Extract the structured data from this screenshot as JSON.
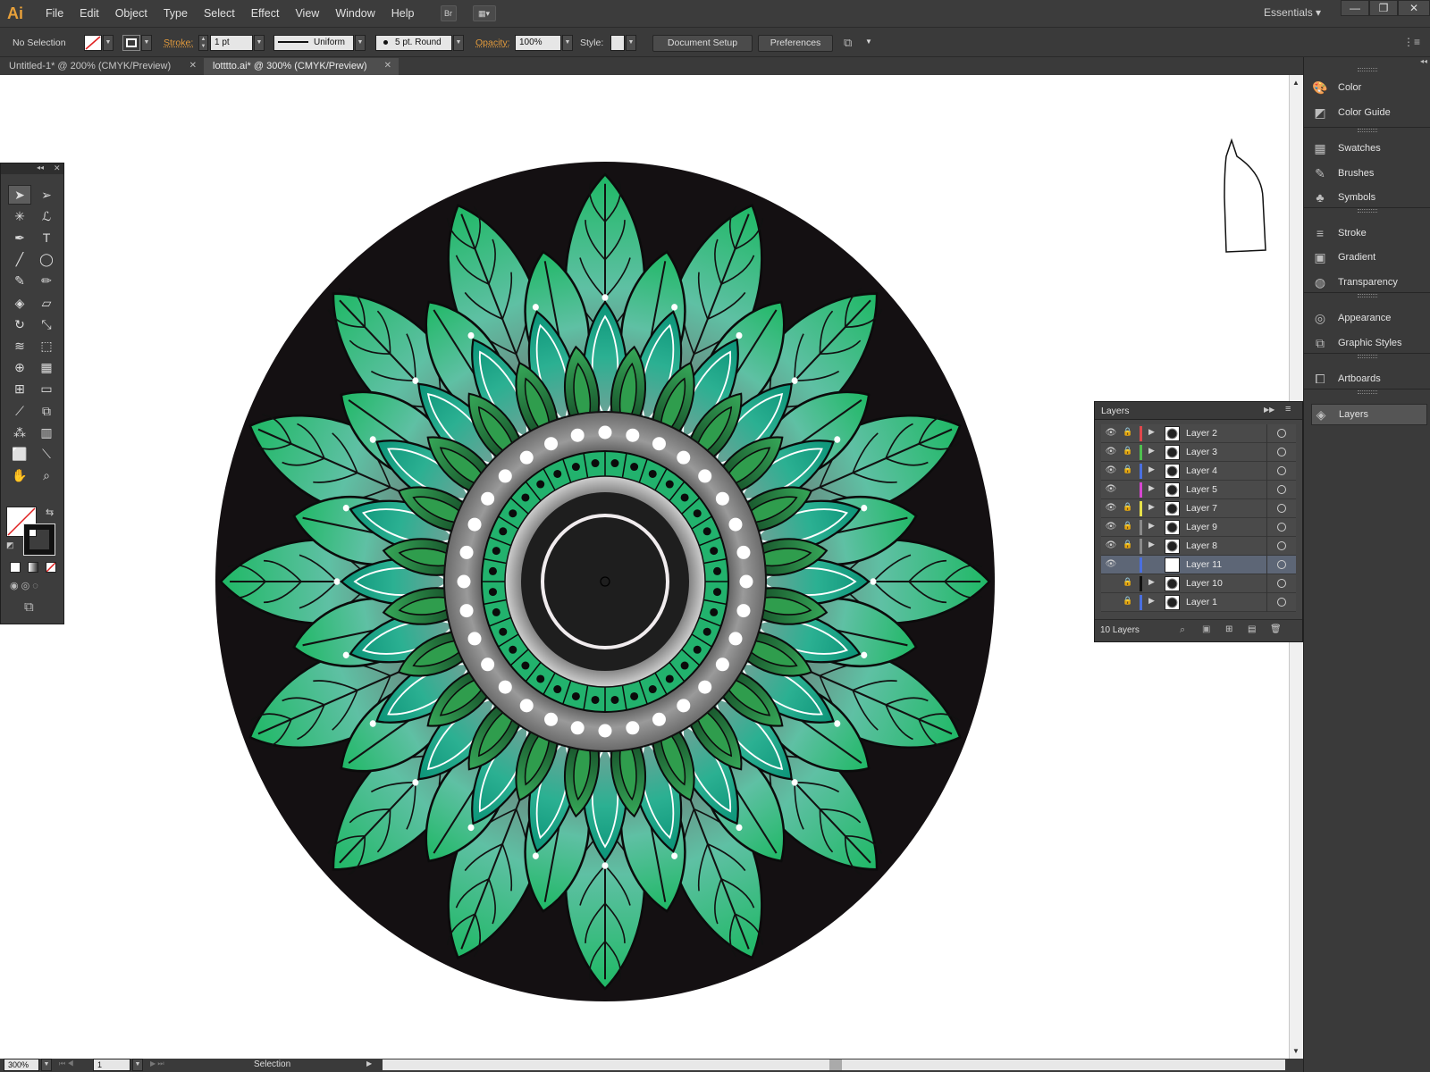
{
  "app": {
    "logo": "Ai"
  },
  "menu": [
    "File",
    "Edit",
    "Object",
    "Type",
    "Select",
    "Effect",
    "View",
    "Window",
    "Help"
  ],
  "menubar_extra": {
    "bridge_label": "Br",
    "workspace": "Essentials",
    "workspace_arrow": "▾"
  },
  "window_controls": {
    "minimize": "—",
    "restore": "❐",
    "close": "✕"
  },
  "control_bar": {
    "selection_status": "No Selection",
    "stroke_label": "Stroke:",
    "stroke_weight": "1 pt",
    "stroke_profile": "Uniform",
    "brush_def": "5 pt. Round",
    "opacity_label": "Opacity:",
    "opacity_value": "100%",
    "style_label": "Style:",
    "document_setup": "Document Setup",
    "preferences": "Preferences"
  },
  "tabs": [
    {
      "label": "Untitled-1* @ 200% (CMYK/Preview)",
      "active": false
    },
    {
      "label": "lotttto.ai* @ 300% (CMYK/Preview)",
      "active": true
    }
  ],
  "tab_close": "✕",
  "tools": [
    {
      "name": "selection-tool",
      "glyph": "➤"
    },
    {
      "name": "direct-selection-tool",
      "glyph": "➢"
    },
    {
      "name": "magic-wand-tool",
      "glyph": "✳"
    },
    {
      "name": "lasso-tool",
      "glyph": "ℒ"
    },
    {
      "name": "pen-tool",
      "glyph": "✒"
    },
    {
      "name": "type-tool",
      "glyph": "T"
    },
    {
      "name": "line-segment-tool",
      "glyph": "╱"
    },
    {
      "name": "ellipse-tool",
      "glyph": "◯"
    },
    {
      "name": "paintbrush-tool",
      "glyph": "✎"
    },
    {
      "name": "pencil-tool",
      "glyph": "✏"
    },
    {
      "name": "blob-brush-tool",
      "glyph": "◈"
    },
    {
      "name": "eraser-tool",
      "glyph": "▱"
    },
    {
      "name": "rotate-tool",
      "glyph": "↻"
    },
    {
      "name": "scale-tool",
      "glyph": "⤡"
    },
    {
      "name": "warp-tool",
      "glyph": "≋"
    },
    {
      "name": "free-transform-tool",
      "glyph": "⬚"
    },
    {
      "name": "shape-builder-tool",
      "glyph": "⊕"
    },
    {
      "name": "perspective-grid-tool",
      "glyph": "▦"
    },
    {
      "name": "mesh-tool",
      "glyph": "⊞"
    },
    {
      "name": "gradient-tool",
      "glyph": "▭"
    },
    {
      "name": "eyedropper-tool",
      "glyph": "⟋"
    },
    {
      "name": "blend-tool",
      "glyph": "⧉"
    },
    {
      "name": "symbol-sprayer-tool",
      "glyph": "⁂"
    },
    {
      "name": "column-graph-tool",
      "glyph": "▥"
    },
    {
      "name": "artboard-tool",
      "glyph": "⬜"
    },
    {
      "name": "slice-tool",
      "glyph": "⟍"
    },
    {
      "name": "hand-tool",
      "glyph": "✋"
    },
    {
      "name": "zoom-tool",
      "glyph": "⌕"
    }
  ],
  "dock": [
    {
      "label": "Color",
      "icon": "color-icon",
      "glyph": "🎨"
    },
    {
      "label": "Color Guide",
      "icon": "color-guide-icon",
      "glyph": "◩"
    },
    {
      "label": "Swatches",
      "icon": "swatches-icon",
      "glyph": "▦"
    },
    {
      "label": "Brushes",
      "icon": "brushes-icon",
      "glyph": "✎"
    },
    {
      "label": "Symbols",
      "icon": "symbols-icon",
      "glyph": "♣"
    },
    {
      "label": "Stroke",
      "icon": "stroke-icon",
      "glyph": "≡"
    },
    {
      "label": "Gradient",
      "icon": "gradient-icon",
      "glyph": "▣"
    },
    {
      "label": "Transparency",
      "icon": "transparency-icon",
      "glyph": "◍"
    },
    {
      "label": "Appearance",
      "icon": "appearance-icon",
      "glyph": "◎"
    },
    {
      "label": "Graphic Styles",
      "icon": "graphic-styles-icon",
      "glyph": "⧉"
    },
    {
      "label": "Artboards",
      "icon": "artboards-icon",
      "glyph": "⧠"
    },
    {
      "label": "Layers",
      "icon": "layers-icon",
      "glyph": "◈"
    }
  ],
  "layers_panel": {
    "title": "Layers",
    "count": "10 Layers",
    "expand_glyph": "▶▶",
    "menu_glyph": "≡",
    "layers": [
      {
        "name": "Layer 2",
        "color": "#e0474c",
        "visible": true,
        "locked": true,
        "selected": false
      },
      {
        "name": "Layer 3",
        "color": "#4fc04f",
        "visible": true,
        "locked": true,
        "selected": false
      },
      {
        "name": "Layer 4",
        "color": "#4a6fe0",
        "visible": true,
        "locked": true,
        "selected": false
      },
      {
        "name": "Layer 5",
        "color": "#d646d0",
        "visible": true,
        "locked": false,
        "selected": false
      },
      {
        "name": "Layer 7",
        "color": "#e5e04a",
        "visible": true,
        "locked": true,
        "selected": false
      },
      {
        "name": "Layer 9",
        "color": "#8a8a8a",
        "visible": true,
        "locked": true,
        "selected": false
      },
      {
        "name": "Layer 8",
        "color": "#8a8a8a",
        "visible": true,
        "locked": true,
        "selected": false
      },
      {
        "name": "Layer 11",
        "color": "#4a6fe0",
        "visible": true,
        "locked": false,
        "selected": true
      },
      {
        "name": "Layer 10",
        "color": "#111111",
        "visible": false,
        "locked": true,
        "selected": false
      },
      {
        "name": "Layer 1",
        "color": "#4a6fe0",
        "visible": false,
        "locked": true,
        "selected": false
      }
    ]
  },
  "status_bar": {
    "zoom": "300%",
    "artboard": "1",
    "tool": "Selection"
  },
  "colors": {
    "leaf_light": "#5fc0a4",
    "leaf_bright": "#1fb865",
    "leaf_dark": "#0d8a6e",
    "petal_deep": "#2b8a43",
    "bg_disc": "#141012",
    "ring_grey": "#8f8f8f",
    "inner_green": "#22b26d"
  }
}
